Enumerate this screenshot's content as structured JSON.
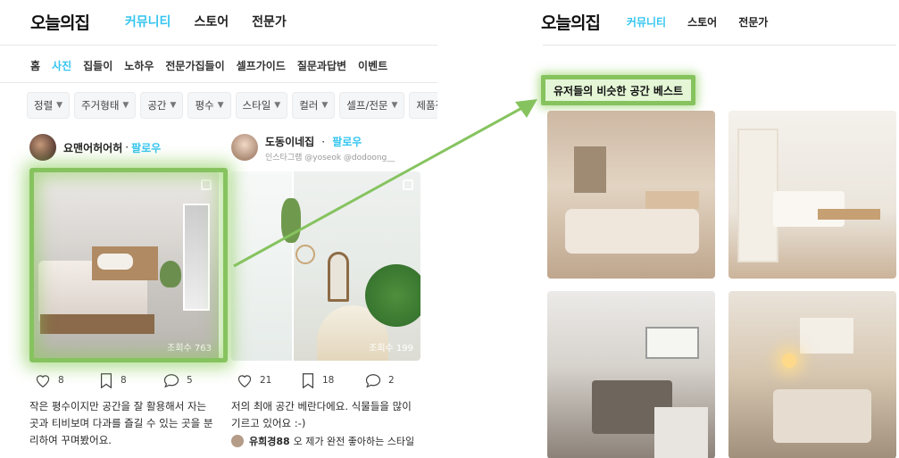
{
  "left": {
    "logo": "오늘의집",
    "nav": [
      "커뮤니티",
      "스토어",
      "전문가"
    ],
    "subnav": [
      "홈",
      "사진",
      "집들이",
      "노하우",
      "전문가집들이",
      "셀프가이드",
      "질문과답변",
      "이벤트"
    ],
    "filters": [
      "정렬",
      "주거형태",
      "공간",
      "평수",
      "스타일",
      "컬러",
      "셀프/전문",
      "제품정"
    ],
    "cards": [
      {
        "author": "요맨어허어허",
        "follow": "팔로우",
        "views": "조회수 763",
        "likes": "8",
        "scraps": "8",
        "comments": "5",
        "caption": "작은 평수이지만 공간을 잘 활용해서 자는 곳과 티비보며 다과를 즐길 수 있는 곳을 분리하여 꾸며봤어요."
      },
      {
        "author": "도동이네집",
        "follow": "팔로우",
        "handle": "인스타그램 @yoseok @dodoong__",
        "views": "조회수 199",
        "likes": "21",
        "scraps": "18",
        "comments": "2",
        "caption": "저의 최애 공간 베란다에요. 식물들을 많이 기르고 있어요 :-)",
        "commenter": "유희경88",
        "comment_text": "오 제가 완전 좋아하는 스타일"
      }
    ]
  },
  "right": {
    "logo": "오늘의집",
    "nav": [
      "커뮤니티",
      "스토어",
      "전문가"
    ],
    "section_title": "유저들의 비슷한 공간 베스트"
  },
  "colors": {
    "accent": "#35c5f0",
    "highlight": "#86c35f"
  }
}
